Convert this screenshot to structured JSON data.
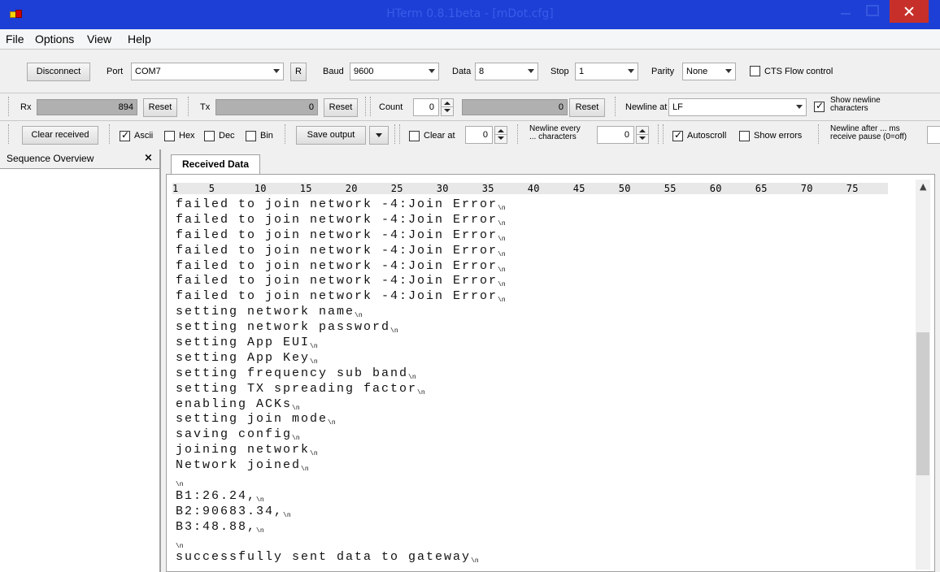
{
  "window": {
    "title": "HTerm 0.8.1beta - [mDot.cfg]",
    "close_label": "✕"
  },
  "menu": [
    "File",
    "Options",
    "View",
    "Help"
  ],
  "connection": {
    "disconnect_label": "Disconnect",
    "port_label": "Port",
    "port_value": "COM7",
    "r_label": "R",
    "baud_label": "Baud",
    "baud_value": "9600",
    "data_label": "Data",
    "data_value": "8",
    "stop_label": "Stop",
    "stop_value": "1",
    "parity_label": "Parity",
    "parity_value": "None",
    "cts_label": "CTS Flow control",
    "cts_checked": false
  },
  "counters": {
    "rx_label": "Rx",
    "rx_value": "894",
    "rx_reset_label": "Reset",
    "tx_label": "Tx",
    "tx_value": "0",
    "tx_reset_label": "Reset",
    "count_label": "Count",
    "count_value": "0",
    "count_meter_value": "0",
    "count_reset_label": "Reset",
    "newline_at_label": "Newline at",
    "newline_at_value": "LF",
    "show_newline_label": "Show newline\ncharacters",
    "show_newline_checked": true
  },
  "display": {
    "clear_received_label": "Clear received",
    "ascii_label": "Ascii",
    "ascii_checked": true,
    "hex_label": "Hex",
    "dec_label": "Dec",
    "bin_label": "Bin",
    "save_output_label": "Save output",
    "clear_at_label": "Clear at",
    "clear_at_value": "0",
    "newline_every_label": "Newline every\n... characters",
    "newline_every_value": "0",
    "autoscroll_label": "Autoscroll",
    "autoscroll_checked": true,
    "show_errors_label": "Show errors",
    "newline_after_label": "Newline after ... ms\nreceive pause (0=off)"
  },
  "sequence_panel": {
    "title": "Sequence Overview",
    "close_label": "×"
  },
  "received": {
    "tab_label": "Received Data",
    "ruler_marks": [
      "1",
      "5",
      "10",
      "15",
      "20",
      "25",
      "30",
      "35",
      "40",
      "45",
      "50",
      "55",
      "60",
      "65",
      "70",
      "75"
    ],
    "newline_marker": "\\n",
    "lines": [
      "failed to join network -4:Join Error",
      "failed to join network -4:Join Error",
      "failed to join network -4:Join Error",
      "failed to join network -4:Join Error",
      "failed to join network -4:Join Error",
      "failed to join network -4:Join Error",
      "failed to join network -4:Join Error",
      "setting network name",
      "setting network password",
      "setting App EUI",
      "setting App Key",
      "setting frequency sub band",
      "setting TX spreading factor",
      "enabling ACKs",
      "setting join mode",
      "saving config",
      "joining network",
      "Network joined",
      "",
      "B1:26.24,",
      "B2:90683.34,",
      "B3:48.88,",
      "",
      "successfully sent data to gateway"
    ],
    "scroll_up_icon": "▲"
  }
}
